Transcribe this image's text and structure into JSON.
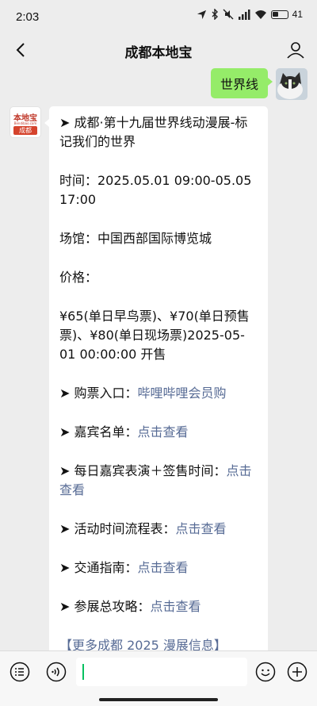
{
  "status": {
    "time": "2:03",
    "battery": "41"
  },
  "nav": {
    "title": "成都本地宝"
  },
  "sent": {
    "text": "世界线"
  },
  "bot_avatar": {
    "top": "本地宝",
    "sub": "Bendibao.com",
    "bottom": "成都"
  },
  "message": {
    "p1": "➤ 成都·第十九届世界线动漫展-标记我们的世界",
    "p2": "时间：2025.05.01 09:00-05.05 17:00",
    "p3": "场馆：中国西部国际博览城",
    "p4": "价格：",
    "p5": "¥65(单日早鸟票)、¥70(单日预售票)、¥80(单日现场票)2025-05-01 00:00:00 开售",
    "ticket_label": "➤ 购票入口：",
    "ticket_link": "哔哩哔哩会员购",
    "guest_label": "➤ 嘉宾名单：",
    "guest_link": "点击查看",
    "daily_label": "➤ 每日嘉宾表演＋签售时间：",
    "daily_link": "点击查看",
    "schedule_label": "➤ 活动时间流程表：",
    "schedule_link": "点击查看",
    "traffic_label": "➤ 交通指南：",
    "traffic_link": "点击查看",
    "guide_label": "➤ 参展总攻略：",
    "guide_link": "点击查看",
    "more": "【更多成都 2025 漫展信息】"
  }
}
